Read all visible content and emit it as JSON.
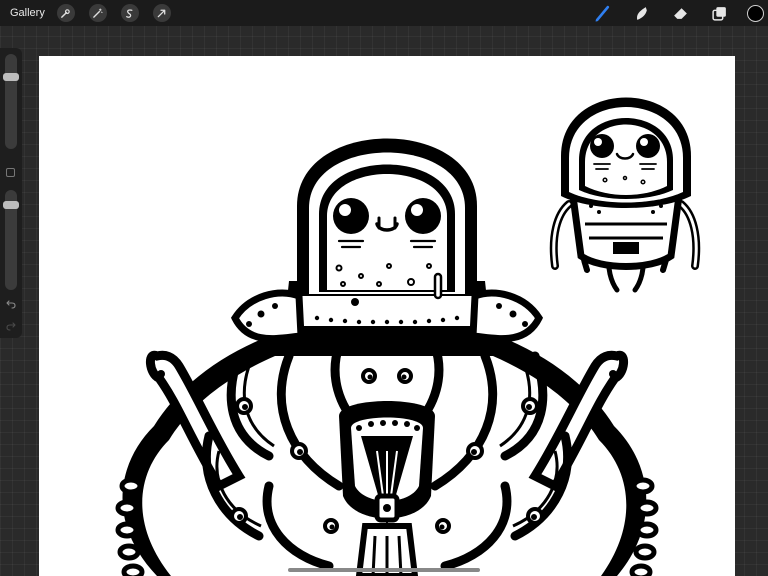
{
  "topbar": {
    "gallery_label": "Gallery",
    "left_tools": [
      {
        "icon": "wrench-icon",
        "name": "actions"
      },
      {
        "icon": "magic-wand-icon",
        "name": "adjustments"
      },
      {
        "icon": "selection-icon",
        "name": "selection"
      },
      {
        "icon": "transform-arrow-icon",
        "name": "transform"
      }
    ],
    "right_tools": [
      {
        "icon": "brush-icon",
        "name": "paint",
        "active": true
      },
      {
        "icon": "smudge-icon",
        "name": "smudge",
        "active": false
      },
      {
        "icon": "eraser-icon",
        "name": "eraser",
        "active": false
      },
      {
        "icon": "layers-icon",
        "name": "layers",
        "active": false
      }
    ],
    "current_color": "#000000",
    "accent_color": "#2f7ff0"
  },
  "sidebar": {
    "brush_size_level": 0.22,
    "opacity_level": 0.12
  }
}
